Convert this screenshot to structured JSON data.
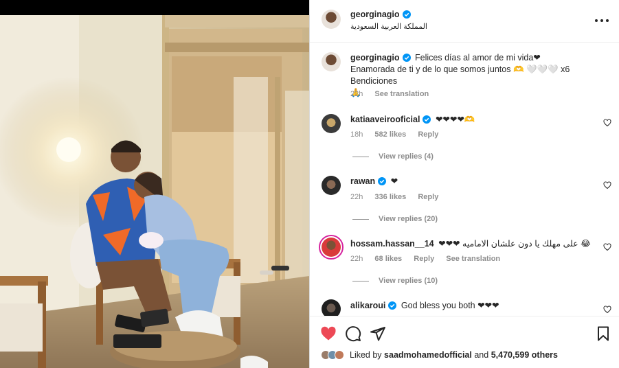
{
  "post": {
    "author": "georginagio",
    "location": "المملكة العربية السعودية"
  },
  "caption": {
    "author": "georginagio",
    "text_line1": "Felices días al amor de mi vida❤",
    "text_line2": "Enamorada de ti y de lo que somos juntos 🫶 🤍🤍🤍 x6 Bendiciones",
    "text_line3": "🙏",
    "time": "22h",
    "see_translation": "See translation"
  },
  "comments": [
    {
      "user": "katiaaveirooficial",
      "text": "❤❤❤❤🫶",
      "time": "18h",
      "likes": "582 likes",
      "reply": "Reply",
      "view_replies": "View replies (4)"
    },
    {
      "user": "rawan",
      "text": "❤",
      "time": "22h",
      "likes": "336 likes",
      "reply": "Reply",
      "view_replies": "View replies (20)"
    },
    {
      "user": "hossam.hassan__14",
      "text": "❤❤❤ على مهلك يا دون علشان الاماميه 😂",
      "time": "22h",
      "likes": "68 likes",
      "reply": "Reply",
      "see_translation": "See translation",
      "view_replies": "View replies (10)"
    },
    {
      "user": "alikaroui",
      "text": "God bless you both ❤❤❤"
    }
  ],
  "likes": {
    "prefix": "Liked by",
    "user": "saadmohamedofficial",
    "and": "and",
    "others": "5,470,599 others"
  },
  "colors": {
    "liked_heart": "#ed4956",
    "verified": "#0095f6",
    "secondary_text": "#8e8e8e"
  },
  "icons": [
    "verified-badge-icon",
    "more-options-icon",
    "heart-icon",
    "comment-icon",
    "share-icon",
    "bookmark-icon"
  ]
}
